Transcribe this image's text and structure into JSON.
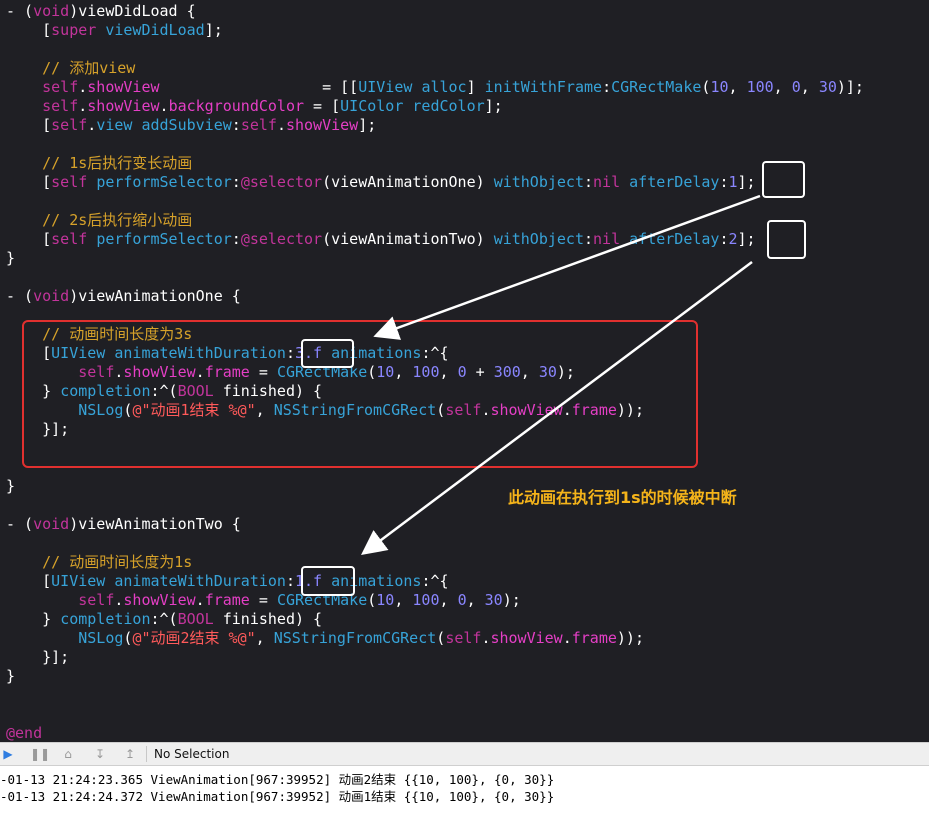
{
  "colors": {
    "editor_bg": "#1f1f24",
    "keyword": "#c2349b",
    "comment": "#d7a22a",
    "class_method": "#37a3d8",
    "property": "#e53fc6",
    "number": "#8a86ff",
    "string": "#ff5a5a",
    "annotation_box": "#ffffff",
    "highlight_box": "#e0302f",
    "annotation_text": "#f5b41a"
  },
  "code": {
    "l1": {
      "a": "- (",
      "b": "void",
      "c": ")viewDidLoad {"
    },
    "l2": {
      "a": "    [",
      "b": "super",
      "c": " ",
      "d": "viewDidLoad",
      "e": "];"
    },
    "l4": {
      "a": "    // 添加view"
    },
    "l5": {
      "a": "    ",
      "b": "self",
      "c": ".",
      "d": "showView",
      "e": "                  = [[",
      "f": "UIView",
      "g": " ",
      "h": "alloc",
      "i": "] ",
      "j": "initWithFrame",
      "k": ":",
      "l": "CGRectMake",
      "m": "(",
      "n": "10",
      "o": ", ",
      "p": "100",
      "q": ", ",
      "r": "0",
      "s": ", ",
      "t": "30",
      "u": ")];"
    },
    "l6": {
      "a": "    ",
      "b": "self",
      "c": ".",
      "d": "showView",
      "e": ".",
      "f": "backgroundColor",
      "g": " = [",
      "h": "UIColor",
      "i": " ",
      "j": "redColor",
      "k": "];"
    },
    "l7": {
      "a": "    [",
      "b": "self",
      "c": ".",
      "d": "view",
      "e": " ",
      "f": "addSubview",
      "g": ":",
      "h": "self",
      "i": ".",
      "j": "showView",
      "k": "];"
    },
    "l9": {
      "a": "    // 1s后执行变长动画"
    },
    "l10": {
      "a": "    [",
      "b": "self",
      "c": " ",
      "d": "performSelector",
      "e": ":",
      "f": "@selector",
      "g": "(viewAnimationOne) ",
      "h": "withObject",
      "i": ":",
      "j": "nil",
      "k": " ",
      "l": "afterDelay",
      "m": ":",
      "n": "1",
      "o": "];"
    },
    "l12": {
      "a": "    // 2s后执行缩小动画"
    },
    "l13": {
      "a": "    [",
      "b": "self",
      "c": " ",
      "d": "performSelector",
      "e": ":",
      "f": "@selector",
      "g": "(viewAnimationTwo) ",
      "h": "withObject",
      "i": ":",
      "j": "nil",
      "k": " ",
      "l": "afterDelay",
      "m": ":",
      "n": "2",
      "o": "];"
    },
    "l14": {
      "a": "}"
    },
    "l16": {
      "a": "- (",
      "b": "void",
      "c": ")viewAnimationOne {"
    },
    "l18": {
      "a": "    // 动画时间长度为3s"
    },
    "l19": {
      "a": "    [",
      "b": "UIView",
      "c": " ",
      "d": "animateWithDuration",
      "e": ":",
      "f": "3.f",
      "g": " ",
      "h": "animations",
      "i": ":^{"
    },
    "l20": {
      "a": "        ",
      "b": "self",
      "c": ".",
      "d": "showView",
      "e": ".",
      "f": "frame",
      "g": " = ",
      "h": "CGRectMake",
      "i": "(",
      "j": "10",
      "k": ", ",
      "l": "100",
      "m": ", ",
      "n": "0",
      "o": " + ",
      "p": "300",
      "q": ", ",
      "r": "30",
      "s": ");"
    },
    "l21": {
      "a": "    } ",
      "b": "completion",
      "c": ":^(",
      "d": "BOOL",
      "e": " finished) {"
    },
    "l22": {
      "a": "        ",
      "b": "NSLog",
      "c": "(",
      "d": "@\"动画1结束 %@\"",
      "e": ", ",
      "f": "NSStringFromCGRect",
      "g": "(",
      "h": "self",
      "i": ".",
      "j": "showView",
      "k": ".",
      "l": "frame",
      "m": "));"
    },
    "l23": {
      "a": "    }];"
    },
    "l25": {
      "a": "}"
    },
    "l27": {
      "a": "- (",
      "b": "void",
      "c": ")viewAnimationTwo {"
    },
    "l29": {
      "a": "    // 动画时间长度为1s"
    },
    "l30": {
      "a": "    [",
      "b": "UIView",
      "c": " ",
      "d": "animateWithDuration",
      "e": ":",
      "f": "1.f",
      "g": " ",
      "h": "animations",
      "i": ":^{"
    },
    "l31": {
      "a": "        ",
      "b": "self",
      "c": ".",
      "d": "showView",
      "e": ".",
      "f": "frame",
      "g": " = ",
      "h": "CGRectMake",
      "i": "(",
      "j": "10",
      "k": ", ",
      "l": "100",
      "m": ", ",
      "n": "0",
      "o": ", ",
      "p": "30",
      "q": ");"
    },
    "l32": {
      "a": "    } ",
      "b": "completion",
      "c": ":^(",
      "d": "BOOL",
      "e": " finished) {"
    },
    "l33": {
      "a": "        ",
      "b": "NSLog",
      "c": "(",
      "d": "@\"动画2结束 %@\"",
      "e": ", ",
      "f": "NSStringFromCGRect",
      "g": "(",
      "h": "self",
      "i": ".",
      "j": "showView",
      "k": ".",
      "l": "frame",
      "m": "));"
    },
    "l34": {
      "a": "    }];"
    },
    "l35": {
      "a": "}"
    },
    "l38": {
      "a": "@end"
    }
  },
  "annotation": {
    "text": "此动画在执行到1s的时候被中断"
  },
  "debugbar": {
    "selection_label": "No Selection"
  },
  "console": {
    "lines": [
      "-01-13 21:24:23.365 ViewAnimation[967:39952] 动画2结束 {{10, 100}, {0, 30}}",
      "-01-13 21:24:24.372 ViewAnimation[967:39952] 动画1结束 {{10, 100}, {0, 30}}"
    ]
  }
}
